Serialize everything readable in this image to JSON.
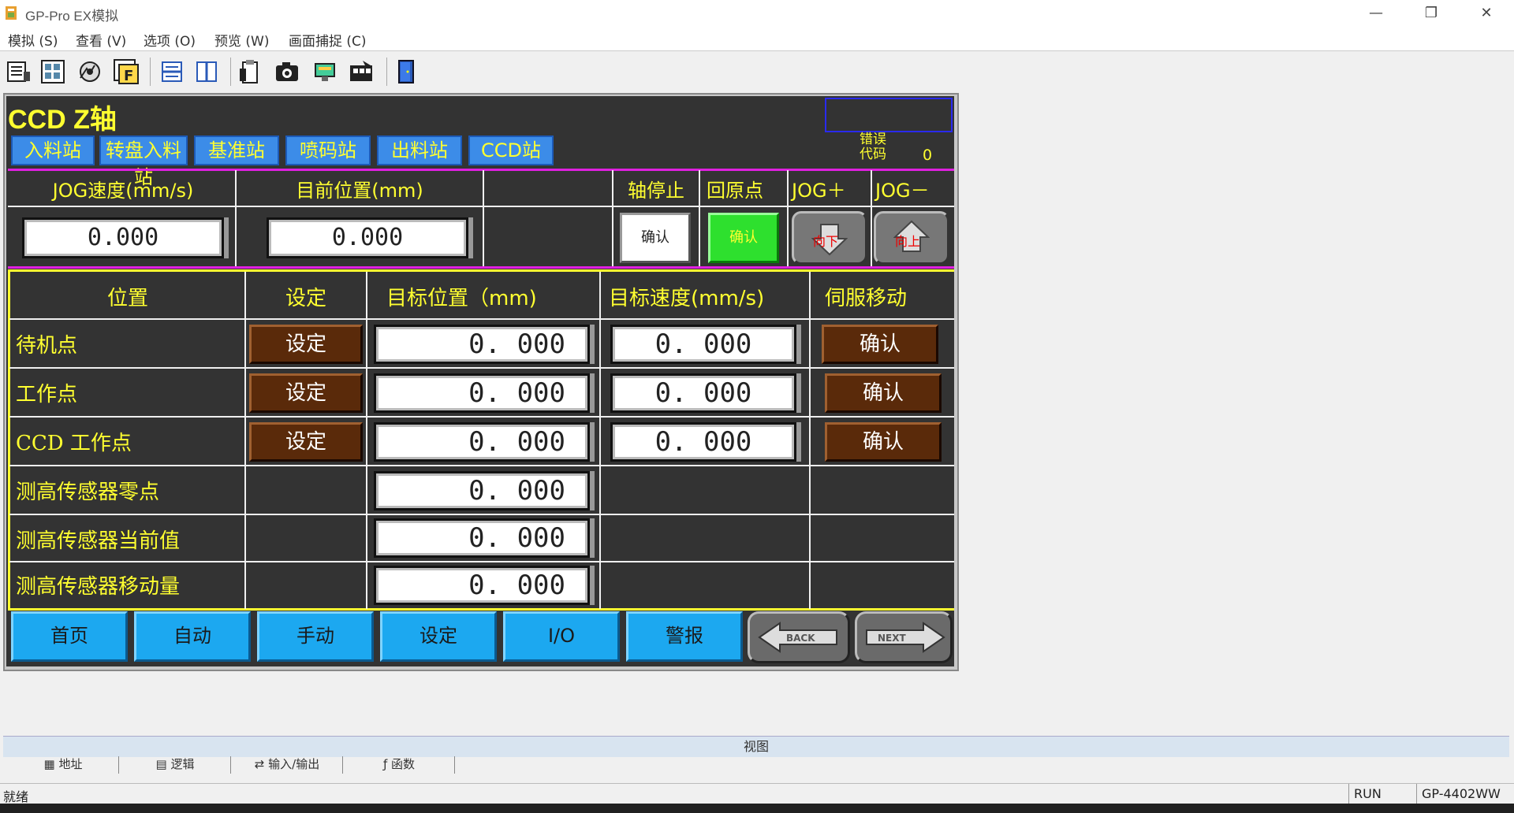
{
  "window": {
    "title": "GP-Pro EX模拟",
    "controls": {
      "minimize": "—",
      "restore": "❐",
      "close": "✕"
    }
  },
  "menu": [
    "模拟 (S)",
    "查看 (V)",
    "选项 (O)",
    "预览 (W)",
    "画面捕捉 (C)"
  ],
  "toolbar_icons": [
    "project-icon",
    "screen-list-icon",
    "settings-wheel-icon",
    "feature-icon",
    "split-horizontal-icon",
    "split-vertical-icon",
    "clipboard-icon",
    "camera-icon",
    "display-icon",
    "film-icon",
    "exit-door-icon"
  ],
  "hmi": {
    "title": "CCD Z轴",
    "stations": [
      "入料站",
      "转盘入料站",
      "基准站",
      "喷码站",
      "出料站",
      "CCD站"
    ],
    "error": {
      "label": "错误代码",
      "value": "0"
    },
    "jog": {
      "speed_label": "JOG速度(mm/s)",
      "position_label": "目前位置(mm)",
      "speed_value": "0.000",
      "position_value": "0.000",
      "stop_label": "轴停止",
      "home_label": "回原点",
      "jog_plus_label": "JOG＋",
      "jog_minus_label": "JOG－",
      "stop_button": "确认",
      "home_button": "确认",
      "down_button": "向下",
      "up_button": "向上"
    },
    "table": {
      "headers": [
        "位置",
        "设定",
        "目标位置（mm)",
        "目标速度(mm/s)",
        "伺服移动"
      ],
      "rows": [
        {
          "label": "待机点",
          "set": "设定",
          "target": "0. 000",
          "speed": "0. 000",
          "move": "确认"
        },
        {
          "label": "工作点",
          "set": "设定",
          "target": "0. 000",
          "speed": "0. 000",
          "move": "确认"
        },
        {
          "label": "CCD 工作点",
          "set": "设定",
          "target": "0. 000",
          "speed": "0. 000",
          "move": "确认"
        },
        {
          "label": "测高传感器零点",
          "target": "0. 000"
        },
        {
          "label": "测高传感器当前值",
          "target": "0. 000"
        },
        {
          "label": "测高传感器移动量",
          "target": "0. 000"
        }
      ]
    },
    "nav": [
      "首页",
      "自动",
      "手动",
      "设定",
      "I/O",
      "警报"
    ],
    "back_label": "BACK",
    "next_label": "NEXT",
    "colors": {
      "label_yellow": "#ffff30",
      "panel": "#333333",
      "nav_blue": "#1ca8f0",
      "green": "#2ee02e",
      "brown": "#5a2a0a"
    }
  },
  "bottom": {
    "view_label": "视图",
    "tabs": [
      "地址",
      "逻辑",
      "输入/输出",
      "函数"
    ],
    "status": "就绪",
    "run": "RUN",
    "model": "GP-4402WW"
  }
}
